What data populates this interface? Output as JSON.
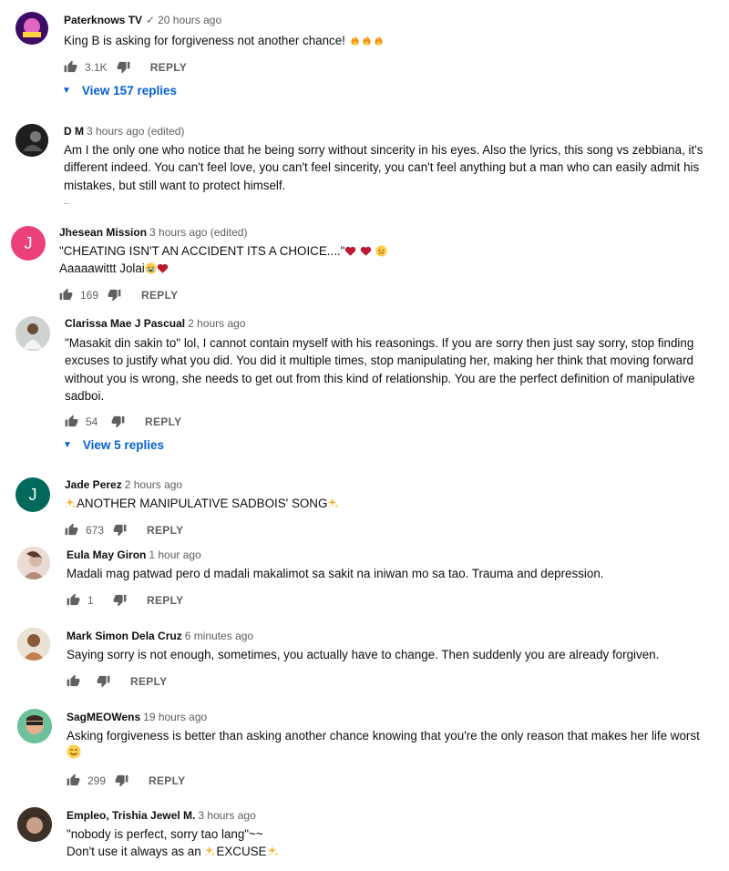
{
  "comments": [
    {
      "author": "Paterknows TV",
      "verified": true,
      "time": "20 hours ago",
      "lines": [
        "King B is asking for forgiveness not another chance! "
      ],
      "likes": "3.1K",
      "reply": "REPLY",
      "view_replies": "View 157 replies",
      "avatar_color": "#7b3fa0"
    },
    {
      "author": "D M",
      "time": "3 hours ago (edited)",
      "lines": [
        "Am I the only one who notice that he being sorry without sincerity in his eyes. Also the lyrics, this song vs zebbiana, it's",
        "different indeed. You can't feel love, you can't feel sincerity, you can't feel anything but a man who can easily admit his",
        "mistakes, but still want to protect himself."
      ],
      "more": "..",
      "avatar_color": "#2b2b2b"
    },
    {
      "author": "Jhesean Mission",
      "time": "3 hours ago (edited)",
      "lines": [
        "\"CHEATING ISN'T AN ACCIDENT ITS A CHOICE....\"",
        "Aaaaawittt Jolai"
      ],
      "likes": "169",
      "reply": "REPLY",
      "avatar_letter": "J",
      "avatar_color": "#ec407a"
    },
    {
      "author": "Clarissa Mae J Pascual",
      "time": "2 hours ago",
      "lines": [
        "\"Masakit din sakin to\" lol, I cannot contain myself with his reasonings. If you are sorry then just say sorry, stop finding",
        "excuses to justify what you did. You did it multiple times, stop manipulating her, making her think that moving forward",
        "without you is wrong, she needs to get out from this kind of relationship. You are the perfect definition of manipulative",
        "sadboi."
      ],
      "likes": "54",
      "reply": "REPLY",
      "view_replies": "View 5 replies",
      "avatar_color": "#8a8f8a"
    },
    {
      "author": "Jade Perez",
      "time": "2 hours ago",
      "lines": [
        "ANOTHER MANIPULATIVE SADBOIS' SONG"
      ],
      "likes": "673",
      "reply": "REPLY",
      "avatar_letter": "J",
      "avatar_color": "#00695c"
    },
    {
      "author": "Eula May Giron",
      "time": "1 hour ago",
      "lines": [
        "Madali mag patwad pero d madali makalimot sa sakit na iniwan mo sa tao. Trauma and depression."
      ],
      "likes": "1",
      "reply": "REPLY",
      "avatar_color": "#c9a99b"
    },
    {
      "author": "Mark Simon Dela Cruz",
      "time": "6 minutes ago",
      "lines": [
        "Saying sorry is not enough, sometimes, you actually have to change. Then suddenly you are already forgiven."
      ],
      "likes": "",
      "reply": "REPLY",
      "avatar_color": "#b08060"
    },
    {
      "author": "SagMEOWens",
      "time": "19 hours ago",
      "lines": [
        "Asking forgiveness is better than asking another chance knowing that you're the only reason that makes her life worst"
      ],
      "likes": "299",
      "reply": "REPLY",
      "avatar_color": "#7ec8a8"
    },
    {
      "author": "Empleo, Trishia Jewel M.",
      "time": "3 hours ago",
      "lines": [
        "\"nobody is perfect, sorry tao lang\"~~",
        "Don't use it always as an ",
        "EXCUSE"
      ],
      "avatar_color": "#4a3a30"
    }
  ]
}
